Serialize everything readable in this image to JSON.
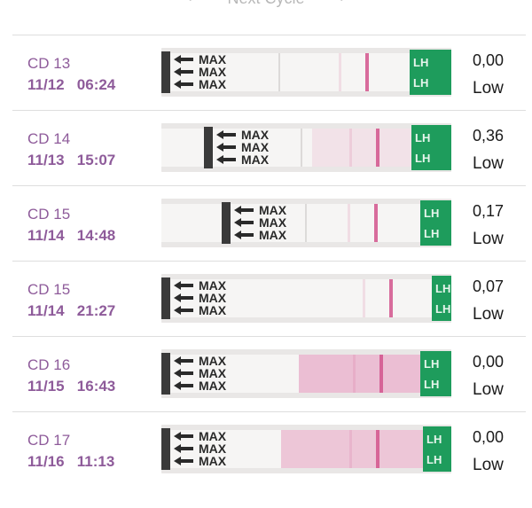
{
  "nav": {
    "prev_icon": "chevron-left-icon",
    "title": "Next Cycle",
    "next_icon": "chevron-right-icon"
  },
  "tests": [
    {
      "cycle_day": "CD 13",
      "date": "11/12",
      "time": "06:24",
      "value": "0,00",
      "level": "Low",
      "tint": 0.05
    },
    {
      "cycle_day": "CD 14",
      "date": "11/13",
      "time": "15:07",
      "value": "0,36",
      "level": "Low",
      "tint": 0.12
    },
    {
      "cycle_day": "CD 15",
      "date": "11/14",
      "time": "14:48",
      "value": "0,17",
      "level": "Low",
      "tint": 0.08
    },
    {
      "cycle_day": "CD 15",
      "date": "11/14",
      "time": "21:27",
      "value": "0,07",
      "level": "Low",
      "tint": 0.05
    },
    {
      "cycle_day": "CD 16",
      "date": "11/15",
      "time": "16:43",
      "value": "0,00",
      "level": "Low",
      "tint": 0.35
    },
    {
      "cycle_day": "CD 17",
      "date": "11/16",
      "time": "11:13",
      "value": "0,00",
      "level": "Low",
      "tint": 0.3
    }
  ],
  "strip_text": {
    "max_label": "MAX",
    "lh_label": "LH"
  },
  "colors": {
    "accent": "#8e5b9a",
    "line": "#d2548c",
    "strip_green": "#1e9c5c"
  }
}
